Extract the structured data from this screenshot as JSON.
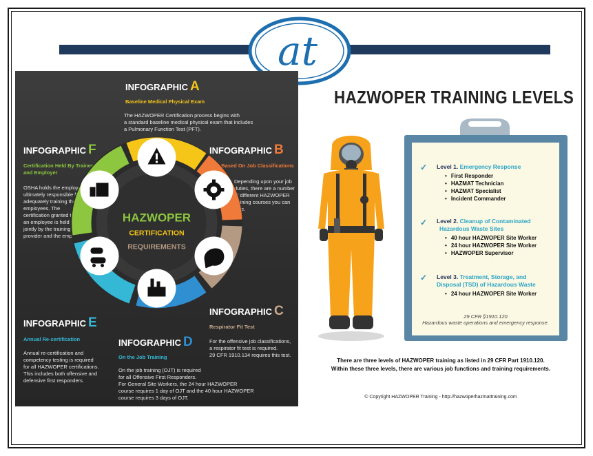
{
  "logo_text": "at",
  "left": {
    "a": {
      "label": "INFOGRAPHIC",
      "letter": "A",
      "subtitle": "Baseline Medical Physical Exam",
      "body": [
        "The HAZWOPER Certification process begins with",
        "a standard baseline medical physical exam that includes",
        "a Pulmonary Function Test (PFT)."
      ]
    },
    "b": {
      "label": "INFOGRAPHIC",
      "letter": "B",
      "subtitle": "Training Based On Job Classifications",
      "body": [
        "Depending upon your job",
        "duties, there are a number",
        "of different HAZWOPER",
        "training courses you can",
        "take."
      ]
    },
    "c": {
      "label": "INFOGRAPHIC",
      "letter": "C",
      "subtitle": "Respirator Fit Test",
      "body": [
        "For the offensive job classifications,",
        "a respirator fit test is required.",
        "29 CFR 1910.134 requires this test."
      ]
    },
    "d": {
      "label": "INFOGRAPHIC",
      "letter": "D",
      "subtitle": "On the Job Training",
      "body": [
        "On the job training (OJT) is required",
        "for all Offensive First Responders.",
        "For General Site Workers, the 24 hour HAZWOPER",
        "course requires 1 day of OJT and the 40 hour HAZWOPER",
        "course requires 3 days of OJT."
      ]
    },
    "e": {
      "label": "INFOGRAPHIC",
      "letter": "E",
      "subtitle": "Annual Re-certification",
      "body": [
        "Annual re-certification and",
        "competency testing is required",
        "for all HAZWOPER certifications.",
        "This includes both offensive and",
        "defensive first responders."
      ]
    },
    "f": {
      "label": "INFOGRAPHIC",
      "letter": "F",
      "subtitle": [
        "Certification Held By Trainer",
        "and Employer"
      ],
      "body": [
        "OSHA holds the employer",
        "ultimately responsible for",
        "adequately training their",
        "employees. The",
        "certification granted to",
        "an employee is held",
        "jointly by the training",
        "provider and the employer."
      ]
    },
    "center": {
      "line1": "HAZWOPER",
      "line2": "CERTIFICATION",
      "line3": "REQUIREMENTS"
    }
  },
  "right": {
    "title": "HAZWOPER TRAINING LEVELS",
    "levels": [
      {
        "prefix": "Level 1.",
        "name": "Emergency Response",
        "items": [
          "First Responder",
          "HAZMAT Technician",
          "HAZMAT Specialist",
          "Incident Commander"
        ]
      },
      {
        "prefix": "Level 2.",
        "name_line1": "Cleanup of Contaminated",
        "name_line2": "Hazardous Waste Sites",
        "items": [
          "40 hour HAZWOPER Site Worker",
          "24 hour HAZWOPER Site Worker",
          "HAZWOPER Supervisor"
        ]
      },
      {
        "prefix": "Level 3.",
        "name_line1": "Treatment, Storage, and",
        "name_line2": "Disposal (TSD) of Hazardous Waste",
        "items": [
          "24 hour HAZWOPER Site Worker"
        ]
      }
    ],
    "cfr_line1": "29 CFR §1910.120",
    "cfr_line2": "Hazardous waste operations and emergency response.",
    "summary_line1": "There are three levels of HAZWOPER training as listed in 29 CFR Part 1910.120.",
    "summary_line2": "Within these three levels, there are various job functions and training requirements.",
    "copyright": "© Copyright HAZWOPER Training - http://hazwoperhazmattraining.com"
  },
  "colors": {
    "navy": "#1f3a5c",
    "a": "#f5c518",
    "b": "#f07a3a",
    "c": "#c9a98e",
    "d": "#2f8fd1",
    "e": "#35b8d6",
    "f": "#8dc63f",
    "suit": "#f7a21b",
    "board": "#5a86a6",
    "paper": "#fbf8e3",
    "accent": "#2aa5c8"
  }
}
